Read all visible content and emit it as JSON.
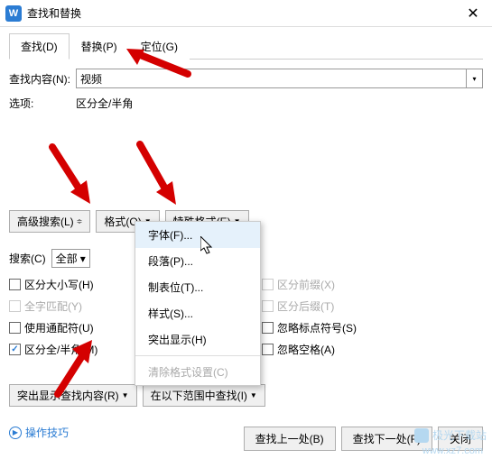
{
  "window": {
    "title": "查找和替换",
    "app_icon_letter": "W"
  },
  "tabs": {
    "find": "查找(D)",
    "replace": "替换(P)",
    "goto": "定位(G)"
  },
  "labels": {
    "find_content": "查找内容(N):",
    "options": "选项:",
    "options_value": "区分全/半角",
    "search_in": "搜索(C)"
  },
  "inputs": {
    "find_value": "视频",
    "search_scope": "全部"
  },
  "buttons": {
    "advanced": "高级搜索(L)",
    "format": "格式(O)",
    "special": "特殊格式(E)",
    "highlight": "突出显示查找内容(R)",
    "find_in": "在以下范围中查找(I)",
    "find_prev": "查找上一处(B)",
    "find_next": "查找下一处(F)",
    "close": "关闭"
  },
  "checks": {
    "case": "区分大小写(H)",
    "wholeword": "全字匹配(Y)",
    "wildcard": "使用通配符(U)",
    "fullhalf": "区分全/半角(M)",
    "prefix": "区分前缀(X)",
    "suffix": "区分后缀(T)",
    "punct": "忽略标点符号(S)",
    "space": "忽略空格(A)"
  },
  "menu": {
    "font": "字体(F)...",
    "para": "段落(P)...",
    "tabs": "制表位(T)...",
    "style": "样式(S)...",
    "highlight": "突出显示(H)",
    "clear": "清除格式设置(C)"
  },
  "links": {
    "help": "操作技巧"
  },
  "watermark": {
    "brand": "极光下载站",
    "url": "www.xz7.com"
  }
}
